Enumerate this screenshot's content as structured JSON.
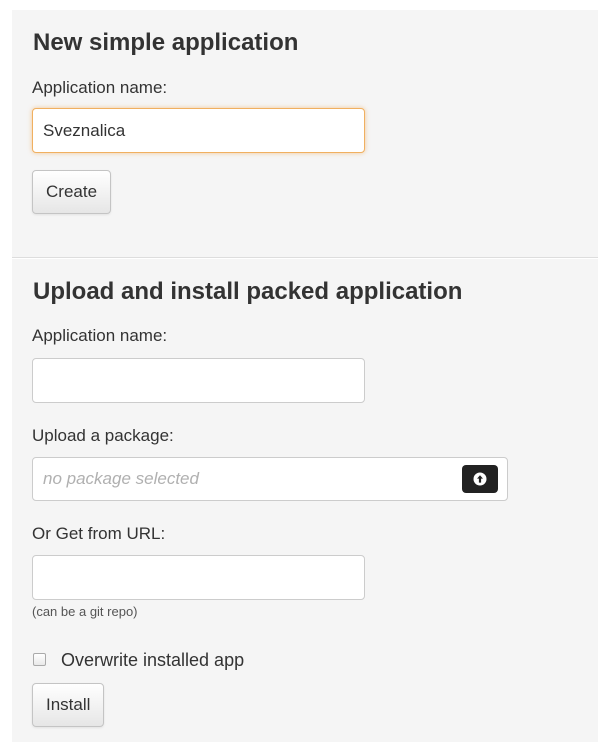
{
  "new_app": {
    "title": "New simple application",
    "name_label": "Application name:",
    "name_value": "Sveznalica",
    "create_label": "Create"
  },
  "upload_app": {
    "title": "Upload and install packed application",
    "name_label": "Application name:",
    "name_value": "",
    "package_label": "Upload a package:",
    "package_placeholder": "no package selected",
    "url_label": "Or Get from URL:",
    "url_value": "",
    "url_hint": "(can be a git repo)",
    "overwrite_label": "Overwrite installed app",
    "overwrite_checked": false,
    "install_label": "Install"
  },
  "icons": {
    "upload": "upload-icon"
  }
}
